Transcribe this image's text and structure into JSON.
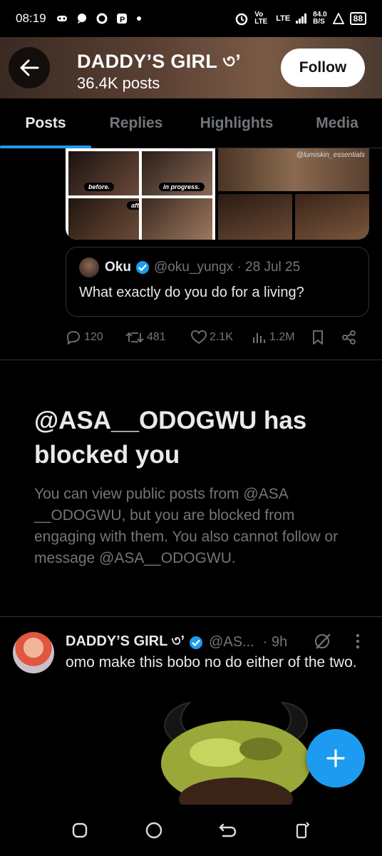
{
  "status_bar": {
    "time": "08:19",
    "network": "Vo LTE",
    "lte": "LTE",
    "speed": "84.0",
    "speed_unit": "B/S",
    "battery": "88"
  },
  "header": {
    "title": "DADDY’S GIRL ৩’",
    "subtitle": "36.4K posts",
    "follow_label": "Follow"
  },
  "tabs": [
    {
      "label": "Posts",
      "active": true
    },
    {
      "label": "Replies",
      "active": false
    },
    {
      "label": "Highlights",
      "active": false
    },
    {
      "label": "Media",
      "active": false
    }
  ],
  "media": {
    "labels": [
      "before.",
      "in progress.",
      "after."
    ],
    "watermark": "@lumiskin_essentials"
  },
  "quote": {
    "name": "Oku",
    "handle": "@oku_yungx · 28 Jul 25",
    "text": "What exactly do you do for a living?"
  },
  "actions": {
    "replies": "120",
    "reposts": "481",
    "likes": "2.1K",
    "views": "1.2M"
  },
  "blocked": {
    "title": "@ASA__ODOGWU has blocked you",
    "body": "You can view public posts from @ASA __ODOGWU, but you are blocked from engaging with them. You also cannot follow or message @ASA__ODOGWU."
  },
  "post2": {
    "name": "DADDY’S GIRL ৩’",
    "handle": "@AS...",
    "time": "· 9h",
    "text": "omo make this bobo no do either of the two."
  },
  "colors": {
    "accent": "#1d9bf0",
    "muted": "#71767b",
    "text": "#e7e9ea",
    "background": "#000000"
  }
}
